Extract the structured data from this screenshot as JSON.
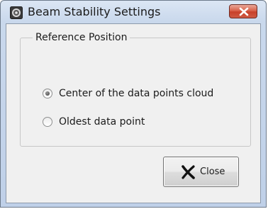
{
  "window": {
    "title": "Beam Stability Settings",
    "icon": "beam-app-icon",
    "close_icon": "close-icon"
  },
  "reference_position": {
    "legend": "Reference Position",
    "options": [
      {
        "label": "Center of the data points cloud",
        "selected": true
      },
      {
        "label": "Oldest data point",
        "selected": false
      }
    ]
  },
  "footer": {
    "close_label": "Close",
    "close_icon": "x-icon"
  },
  "colors": {
    "title_close_button": "#c7402a",
    "dialog_background": "#f0f0f0",
    "frame_gradient": "#c9d8ec"
  }
}
